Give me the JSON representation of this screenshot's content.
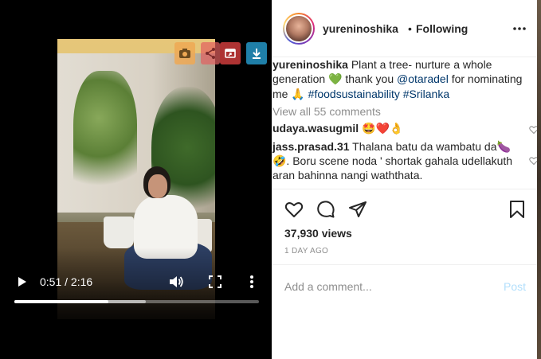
{
  "video": {
    "current_time": "0:51",
    "total_time": "2:16",
    "time_display": "0:51 / 2:16",
    "progress_fraction": 0.383,
    "buffered_fraction": 0.538
  },
  "extension_toolbar": {
    "icons": [
      "camera-icon",
      "share-icon",
      "external-window-icon",
      "download-icon"
    ]
  },
  "post": {
    "author": "yureninoshika",
    "separator": "•",
    "follow_status": "Following",
    "caption": {
      "author": "yureninoshika",
      "text_1": "Plant a tree- nurture a whole generation",
      "emoji_1": "💚",
      "text_2": "thank you",
      "mention": "@otaradel",
      "text_3": "for nominating me",
      "emoji_2": "🙏",
      "hashtag_1": "#foodsustainability",
      "hashtag_2": "#Srilanka"
    },
    "view_all_comments": "View all 55 comments",
    "comments": [
      {
        "user": "udaya.wasugmil",
        "text": "🤩❤️👌"
      },
      {
        "user": "jass.prasad.31",
        "text": "Thalana batu da wambatu da🍆🤣. Boru scene noda ' shortak gahala udellakuth aran bahinna nangi waththata."
      }
    ],
    "views": "37,930 views",
    "time_ago": "1 DAY AGO",
    "add_comment_placeholder": "Add a comment...",
    "post_label": "Post"
  },
  "colors": {
    "link": "#00376b",
    "muted": "#8e8e8e",
    "post_button": "#b2dffc",
    "text": "#262626"
  }
}
